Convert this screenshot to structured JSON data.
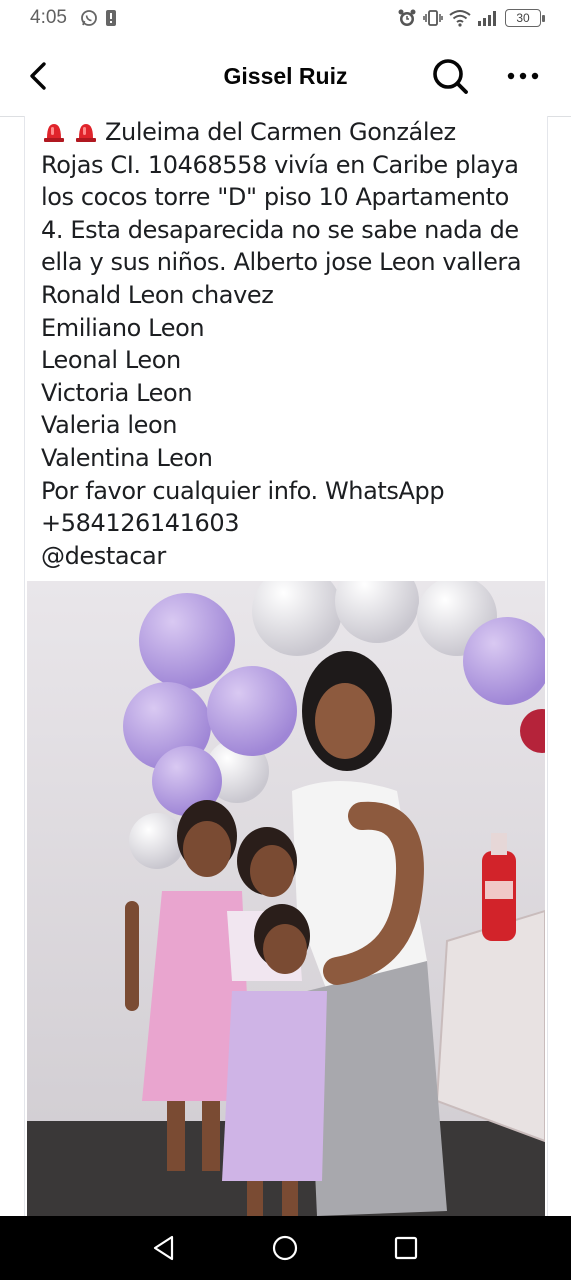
{
  "status_bar": {
    "time": "4:05",
    "battery": "30",
    "left_icons": [
      "whatsapp-icon",
      "notification-icon"
    ],
    "right_icons": [
      "alarm-icon",
      "vibrate-icon",
      "wifi-icon",
      "signal-icon",
      "battery-icon"
    ]
  },
  "header": {
    "title": "Gissel Ruiz",
    "back_icon": "back-arrow-icon",
    "search_icon": "search-icon",
    "more_icon": "more-icon"
  },
  "post": {
    "lines": [
      "Zuleima del Carmen González",
      "Rojas CI. 10468558  vivía en Caribe playa",
      "los cocos torre \"D\" piso 10 Apartamento",
      "4. Esta desaparecida no se sabe nada de",
      "ella y sus niños. Alberto jose Leon vallera",
      "Ronald Leon chavez",
      "Emiliano Leon",
      "Leonal Leon",
      "Victoria Leon",
      "Valeria leon",
      "Valentina Leon",
      "Por favor cualquier info. WhatsApp",
      "+584126141603",
      "@destacar"
    ],
    "leading_emoji": "siren-icon"
  },
  "nav_bar": {
    "buttons": [
      "back-triangle-icon",
      "home-circle-icon",
      "recents-square-icon"
    ]
  },
  "colors": {
    "text": "#1c1e21",
    "divider": "#dddfe2",
    "navbar": "#000000",
    "siren": "#e0242b"
  }
}
